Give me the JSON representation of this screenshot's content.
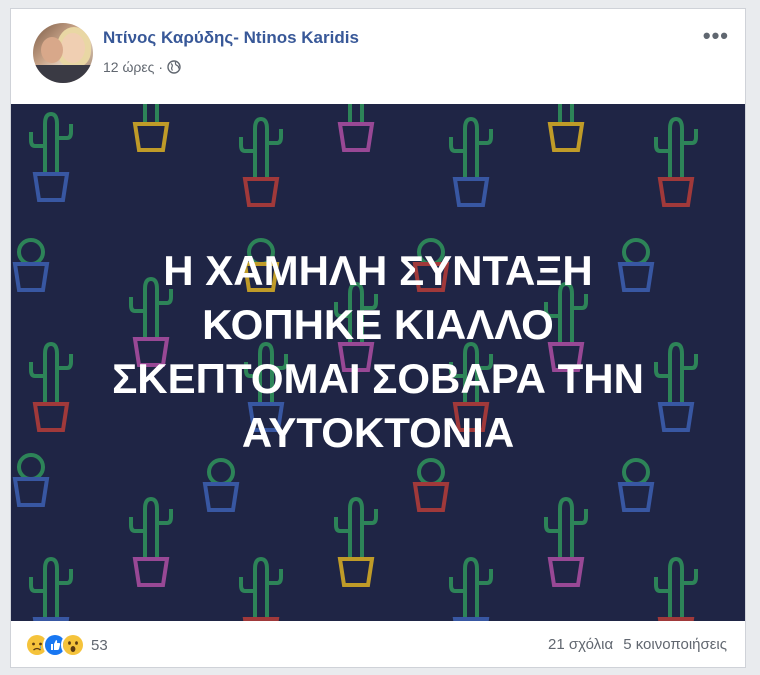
{
  "post": {
    "author": "Ντίνος Καρύδης- Ntinos Karidis",
    "time": "12 ώρες",
    "separator": "·",
    "privacy_icon": "globe-icon",
    "more_label": "•••",
    "image_text_lines": [
      "Η ΧΑΜΗΛΗ ΣΥΝΤΑΞΗ",
      "ΚΟΠΗΚΕ ΚΙΑΛΛΟ",
      "ΣΚΕΠΤΟΜΑΙ ΣΟΒΑΡΑ ΤΗΝ",
      "ΑΥΤΟΚΤΟΝΙΑ"
    ],
    "image_background": "#1f2545",
    "reactions": [
      "sad-icon",
      "like-icon",
      "wow-icon"
    ],
    "reaction_count": "53",
    "comments": "21 σχόλια",
    "shares": "5 κοινοποιήσεις"
  },
  "colors": {
    "author_link": "#385898",
    "meta_text": "#616770"
  }
}
